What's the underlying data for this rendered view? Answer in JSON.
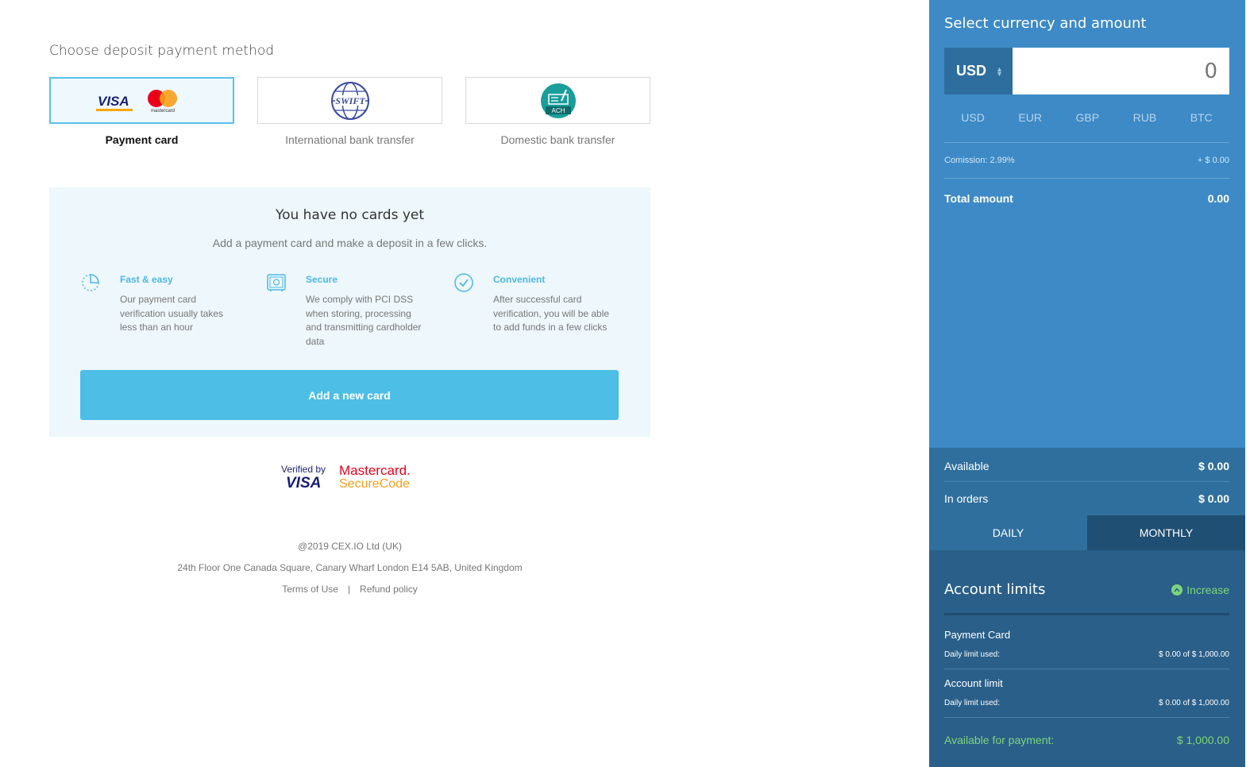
{
  "deposit": {
    "title": "Choose deposit payment method",
    "methods": [
      {
        "label": "Payment card",
        "active": true
      },
      {
        "label": "International bank transfer",
        "active": false
      },
      {
        "label": "Domestic bank transfer",
        "active": false
      }
    ],
    "logos": {
      "visa": "VISA",
      "mastercard": "mastercard",
      "swift": "SWIFT",
      "ach": "ACH"
    }
  },
  "cards_panel": {
    "title": "You have no cards yet",
    "subtitle": "Add a payment card and make a deposit in a few clicks.",
    "features": [
      {
        "icon": "clock-icon",
        "title": "Fast & easy",
        "text": "Our payment card verification usually takes less than an hour"
      },
      {
        "icon": "safe-icon",
        "title": "Secure",
        "text": "We comply with PCI DSS when storing, processing and transmitting cardholder data"
      },
      {
        "icon": "check-circle-icon",
        "title": "Convenient",
        "text": "After successful card verification, you will be able to add funds in a few clicks"
      }
    ],
    "add_button": "Add a new card"
  },
  "verified": {
    "visa_line1": "Verified by",
    "visa_line2": "VISA",
    "mc_line1": "Mastercard.",
    "mc_line2": "SecureCode"
  },
  "footer": {
    "copyright": "@2019 CEX.IO Ltd (UK)",
    "address": "24th Floor One Canada Square, Canary Wharf London E14 5AB, United Kingdom",
    "terms": "Terms of Use",
    "separator": "|",
    "refund": "Refund policy"
  },
  "sidebar": {
    "title": "Select currency and amount",
    "selected_currency": "USD",
    "amount_placeholder": "0",
    "currencies": [
      "USD",
      "EUR",
      "GBP",
      "RUB",
      "BTC"
    ],
    "commission_label": "Comission: 2.99%",
    "commission_value": "+ $ 0.00",
    "total_label": "Total amount",
    "total_value": "0.00",
    "available_label": "Available",
    "available_value": "$ 0.00",
    "in_orders_label": "In orders",
    "in_orders_value": "$ 0.00",
    "tabs": [
      "DAILY",
      "MONTHLY"
    ],
    "limits": {
      "title": "Account limits",
      "increase": "Increase",
      "items": [
        {
          "name": "Payment Card",
          "used_label": "Daily limit used:",
          "used_value": "$ 0.00 of $ 1,000.00"
        },
        {
          "name": "Account limit",
          "used_label": "Daily limit used:",
          "used_value": "$ 0.00 of $ 1,000.00"
        }
      ],
      "available_for_payment_label": "Available for payment:",
      "available_for_payment_value": "$ 1,000.00"
    }
  },
  "colors": {
    "accent": "#4dbee6",
    "sidebar": "#3d8ac6",
    "green": "#7ed67a"
  }
}
